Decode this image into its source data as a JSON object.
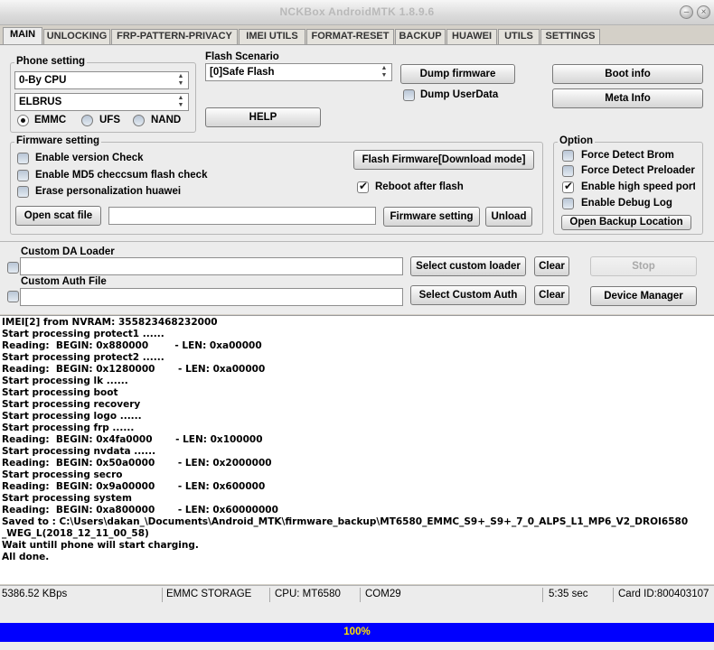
{
  "window": {
    "title": "NCKBox AndroidMTK 1.8.9.6"
  },
  "tabs": [
    "MAIN",
    "UNLOCKING",
    "FRP-PATTERN-PRIVACY",
    "IMEI UTILS",
    "FORMAT-RESET",
    "BACKUP",
    "HUAWEI",
    "UTILS",
    "SETTINGS"
  ],
  "phone_setting": {
    "legend": "Phone setting",
    "cpu_value": "0-By CPU",
    "model_value": "ELBRUS",
    "storage_options": [
      "EMMC",
      "UFS",
      "NAND"
    ],
    "storage_selected": "EMMC"
  },
  "flash_scenario": {
    "label": "Flash Scenario",
    "value": "[0]Safe Flash"
  },
  "buttons": {
    "help": "HELP",
    "dump_firmware": "Dump firmware",
    "boot_info": "Boot info",
    "meta_info": "Meta Info",
    "flash_firmware": "Flash Firmware[Download mode]",
    "open_scat": "Open scat file",
    "firmware_setting": "Firmware setting",
    "unload": "Unload",
    "open_backup": "Open Backup Location",
    "select_loader": "Select custom loader",
    "clear": "Clear",
    "stop": "Stop",
    "select_auth": "Select Custom Auth",
    "device_manager": "Device Manager"
  },
  "dump_userdata_label": "Dump UserData",
  "firmware_setting": {
    "legend": "Firmware setting",
    "enable_version_check": "Enable version Check",
    "enable_md5": "Enable MD5 checcsum flash check",
    "erase_personalization": "Erase personalization huawei",
    "reboot_after_flash": "Reboot after flash",
    "scat_path": ""
  },
  "option": {
    "legend": "Option",
    "items": [
      {
        "label": "Force Detect Brom",
        "checked": false
      },
      {
        "label": "Force Detect Preloader",
        "checked": false
      },
      {
        "label": "Enable high speed port",
        "checked": true
      },
      {
        "label": "Enable Debug Log",
        "checked": false
      }
    ]
  },
  "custom_da": {
    "label": "Custom DA Loader",
    "value": ""
  },
  "custom_auth": {
    "label": "Custom Auth File",
    "value": ""
  },
  "log": [
    "IMEI[2] from NVRAM: 355823468232000",
    "Start processing protect1 ......",
    "Reading:  BEGIN: 0x880000        - LEN: 0xa00000",
    "Start processing protect2 ......",
    "Reading:  BEGIN: 0x1280000       - LEN: 0xa00000",
    "Start processing lk ......",
    "Start processing boot",
    "Start processing recovery",
    "Start processing logo ......",
    "Start processing frp ......",
    "Reading:  BEGIN: 0x4fa0000       - LEN: 0x100000",
    "Start processing nvdata ......",
    "Reading:  BEGIN: 0x50a0000       - LEN: 0x2000000",
    "Start processing secro",
    "Reading:  BEGIN: 0x9a00000       - LEN: 0x600000",
    "Start processing system",
    "Reading:  BEGIN: 0xa800000       - LEN: 0x60000000",
    "Saved to : C:\\Users\\dakan_\\Documents\\Android_MTK\\firmware_backup\\MT6580_EMMC_S9+_S9+_7_0_ALPS_L1_MP6_V2_DROI6580",
    "_WEG_L(2018_12_11_00_58)",
    "Wait untill phone will start charging.",
    "All done."
  ],
  "status": {
    "speed": "5386.52 KBps",
    "storage": "EMMC STORAGE",
    "cpu": "CPU: MT6580",
    "port": "COM29",
    "time": "5:35 sec",
    "card": "Card ID:800403107"
  },
  "progress": {
    "text": "100%",
    "fraction": 1.0
  }
}
